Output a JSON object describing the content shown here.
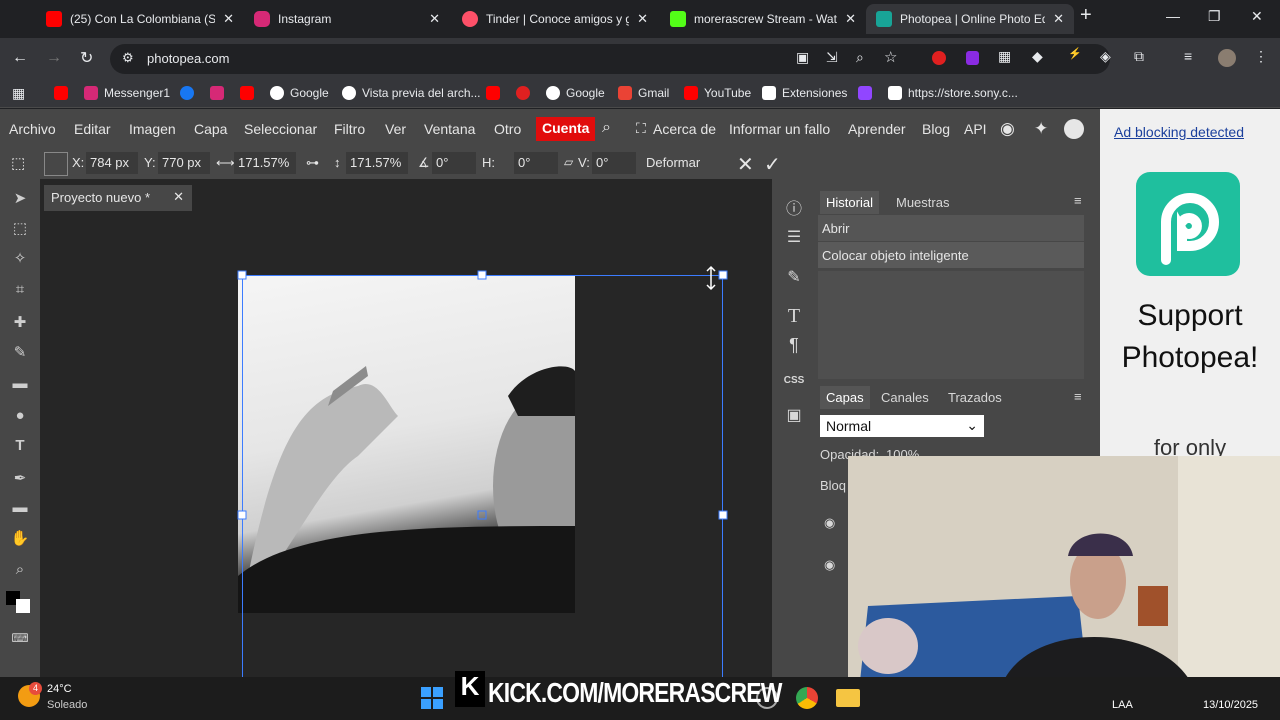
{
  "browser": {
    "tabs": [
      {
        "title": "(25) Con La Colombiana (Sal",
        "icon": "youtube-icon",
        "color": "#ff0000"
      },
      {
        "title": "Instagram",
        "icon": "instagram-icon",
        "color": "#d62976"
      },
      {
        "title": "Tinder | Conoce amigos y ge",
        "icon": "tinder-icon",
        "color": "#fd5068"
      },
      {
        "title": "morerascrew Stream - Watc",
        "icon": "kick-icon",
        "color": "#53fc18"
      },
      {
        "title": "Photopea | Online Photo Edi",
        "icon": "photopea-icon",
        "color": "#18a497"
      }
    ],
    "url": "photopea.com",
    "bookmarks": [
      {
        "label": "",
        "icon": "youtube-icon",
        "color": "#ff0000"
      },
      {
        "label": "Messenger1",
        "icon": "instagram-icon",
        "color": "#d62976"
      },
      {
        "label": "",
        "icon": "facebook-icon",
        "color": "#1877f2"
      },
      {
        "label": "",
        "icon": "instagram-icon",
        "color": "#d62976"
      },
      {
        "label": "",
        "icon": "youtube-icon",
        "color": "#ff0000"
      },
      {
        "label": "Google",
        "icon": "google-icon",
        "color": "#ffffff"
      },
      {
        "label": "Vista previa del arch...",
        "icon": "chrome-icon",
        "color": "#ffffff"
      },
      {
        "label": "",
        "icon": "youtube-icon",
        "color": "#ff0000"
      },
      {
        "label": "",
        "icon": "app-icon",
        "color": "#e02020"
      },
      {
        "label": "Google",
        "icon": "google-icon",
        "color": "#ffffff"
      },
      {
        "label": "Gmail",
        "icon": "gmail-icon",
        "color": "#ea4335"
      },
      {
        "label": "YouTube",
        "icon": "youtube-icon",
        "color": "#ff0000"
      },
      {
        "label": "Extensiones",
        "icon": "puzzle-icon",
        "color": "#ffffff"
      },
      {
        "label": "",
        "icon": "twitch-icon",
        "color": "#9146ff"
      },
      {
        "label": "https://store.sony.c...",
        "icon": "sony-icon",
        "color": "#ffffff"
      }
    ]
  },
  "photopea": {
    "menu": [
      "Archivo",
      "Editar",
      "Imagen",
      "Capa",
      "Seleccionar",
      "Filtro",
      "Ver",
      "Ventana",
      "Otro"
    ],
    "account": "Cuenta",
    "menu_right": [
      "Acerca de",
      "Informar un fallo",
      "Aprender",
      "Blog",
      "API"
    ],
    "options": {
      "x_label": "X:",
      "x_value": "784 px",
      "y_label": "Y:",
      "y_value": "770 px",
      "w_value": "171.57%",
      "h_value": "171.57%",
      "angle_value": "0°",
      "skew_h_label": "H:",
      "skew_h_value": "0°",
      "skew_v_label": "V:",
      "skew_v_value": "0°",
      "deform": "Deformar"
    },
    "doc_tab": "Proyecto nuevo *",
    "history_tabs": [
      "Historial",
      "Muestras"
    ],
    "history_items": [
      "Abrir",
      "Colocar objeto inteligente"
    ],
    "layer_tabs": [
      "Capas",
      "Canales",
      "Trazados"
    ],
    "blend_mode": "Normal",
    "opacity_label": "Opacidad:",
    "opacity_value": "100%",
    "lock_label": "Bloq",
    "ad_link": "Ad blocking detected",
    "ad_text": "Support Photopea!",
    "ad_sub": "for only"
  },
  "overlay": "KICK.COM/MORERASCREW",
  "taskbar": {
    "weather_temp": "24°C",
    "weather_text": "Soleado",
    "badge": "4",
    "lang": "LAA",
    "date": "13/10/2025"
  }
}
